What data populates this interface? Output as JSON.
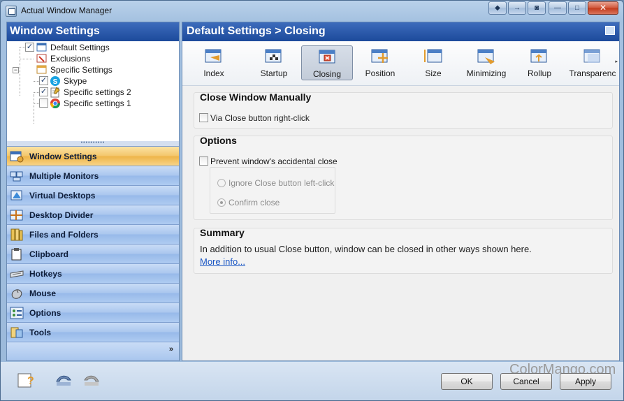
{
  "window": {
    "title": "Actual Window Manager",
    "buttons": [
      "◆",
      "→",
      "◙",
      "—",
      "□",
      "✕"
    ]
  },
  "left_panel": {
    "title": "Window Settings",
    "tree": [
      {
        "label": "Default Settings",
        "checked": true
      },
      {
        "label": "Exclusions"
      },
      {
        "label": "Specific Settings"
      },
      {
        "label": "Skype",
        "checked": true
      },
      {
        "label": "Specific settings 2",
        "checked": true
      },
      {
        "label": "Specific settings 1",
        "checked": false
      }
    ],
    "nav": [
      {
        "label": "Window Settings",
        "icon": "window-settings-icon",
        "active": true
      },
      {
        "label": "Multiple Monitors",
        "icon": "monitors-icon"
      },
      {
        "label": "Virtual Desktops",
        "icon": "virtual-desktops-icon"
      },
      {
        "label": "Desktop Divider",
        "icon": "desktop-divider-icon"
      },
      {
        "label": "Files and Folders",
        "icon": "files-folders-icon"
      },
      {
        "label": "Clipboard",
        "icon": "clipboard-icon"
      },
      {
        "label": "Hotkeys",
        "icon": "keyboard-icon"
      },
      {
        "label": "Mouse",
        "icon": "mouse-icon"
      },
      {
        "label": "Options",
        "icon": "options-icon"
      },
      {
        "label": "Tools",
        "icon": "tools-icon"
      }
    ],
    "footer_chevron": "»"
  },
  "right_panel": {
    "breadcrumb": "Default Settings > Closing",
    "toolbar": [
      {
        "label": "Index"
      },
      {
        "label": "Startup"
      },
      {
        "label": "Closing",
        "active": true
      },
      {
        "label": "Position"
      },
      {
        "label": "Size"
      },
      {
        "label": "Minimizing"
      },
      {
        "label": "Rollup"
      },
      {
        "label": "Transparenc"
      }
    ],
    "toolbar_more": "▸",
    "close_manually": {
      "title": "Close Window Manually",
      "via_close_right_click": "Via Close button right-click"
    },
    "options": {
      "title": "Options",
      "prevent_accidental": "Prevent window's accidental close",
      "ignore_left_click": "Ignore Close button left-click",
      "confirm_close": "Confirm close"
    },
    "summary": {
      "title": "Summary",
      "text": "In addition to usual Close button, window can be closed in other ways shown here.",
      "more_info": "More info..."
    }
  },
  "bottom": {
    "ok": "OK",
    "cancel": "Cancel",
    "apply": "Apply"
  },
  "watermark": {
    "part1": "ColorMango",
    "part2": ".com"
  },
  "colors": {
    "accent": "#1c4a9b",
    "active_nav": "#f3c56a"
  }
}
